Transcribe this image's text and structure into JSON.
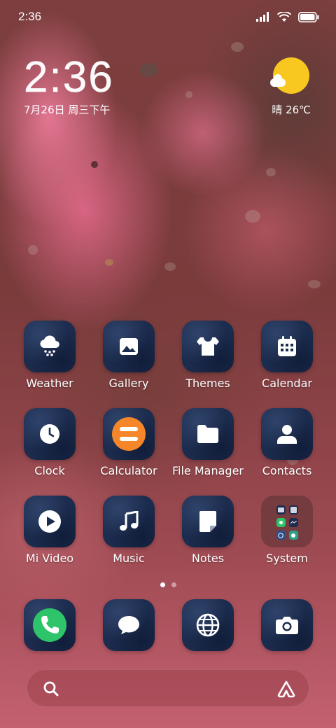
{
  "status_bar": {
    "time": "2:36",
    "icons": [
      "signal-icon",
      "wifi-icon",
      "battery-icon"
    ]
  },
  "clock_widget": {
    "time": "2:36",
    "date": "7月26日 周三下午"
  },
  "weather_widget": {
    "icon": "sunny-cloud-icon",
    "text": "晴 26℃"
  },
  "apps": [
    {
      "label": "Weather",
      "icon": "weather-icon"
    },
    {
      "label": "Gallery",
      "icon": "gallery-icon"
    },
    {
      "label": "Themes",
      "icon": "tshirt-icon"
    },
    {
      "label": "Calendar",
      "icon": "calendar-icon"
    },
    {
      "label": "Clock",
      "icon": "clock-icon"
    },
    {
      "label": "Calculator",
      "icon": "calculator-icon"
    },
    {
      "label": "File Manager",
      "icon": "folder-icon"
    },
    {
      "label": "Contacts",
      "icon": "contacts-icon"
    },
    {
      "label": "Mi Video",
      "icon": "play-icon"
    },
    {
      "label": "Music",
      "icon": "music-note-icon"
    },
    {
      "label": "Notes",
      "icon": "notes-icon"
    },
    {
      "label": "System",
      "icon": "app-folder-icon"
    }
  ],
  "pager": {
    "pages": 2,
    "current": 1
  },
  "dock": [
    {
      "label": "Phone",
      "icon": "phone-icon"
    },
    {
      "label": "Messaging",
      "icon": "chat-bubble-icon"
    },
    {
      "label": "Browser",
      "icon": "globe-icon"
    },
    {
      "label": "Camera",
      "icon": "camera-icon"
    }
  ],
  "search_bar": {
    "left_icon": "search-icon",
    "right_icon": "assistant-icon"
  },
  "colors": {
    "icon_background": "#1c2c4e",
    "calculator_orange": "#f5872a",
    "phone_green": "#2ec46a",
    "sun_yellow": "#f8c820"
  }
}
